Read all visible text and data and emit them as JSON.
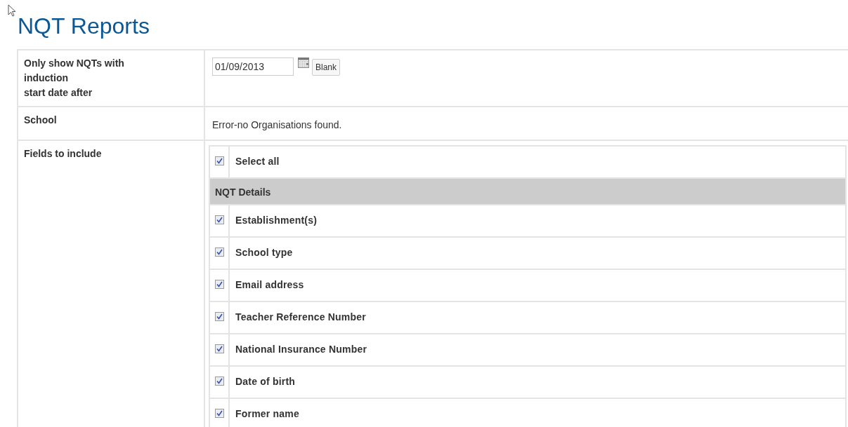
{
  "title": "NQT Reports",
  "filters": [
    {
      "kind": "date",
      "label": "Only show NQTs with\ninduction\nstart date after",
      "value": "01/09/2013",
      "button": "Blank"
    },
    {
      "kind": "text",
      "label": "School",
      "text": "Error-no Organisations found."
    },
    {
      "kind": "fields",
      "label": "Fields to include",
      "select_all": {
        "label": "Select all",
        "checked": true
      },
      "groups": [
        {
          "heading": "NQT Details",
          "fields": [
            {
              "label": "Establishment(s)",
              "checked": true
            },
            {
              "label": "School type",
              "checked": true
            },
            {
              "label": "Email address",
              "checked": true
            },
            {
              "label": "Teacher Reference Number",
              "checked": true
            },
            {
              "label": "National Insurance Number",
              "checked": true
            },
            {
              "label": "Date of birth",
              "checked": true
            },
            {
              "label": "Former name",
              "checked": true
            }
          ]
        }
      ]
    }
  ]
}
